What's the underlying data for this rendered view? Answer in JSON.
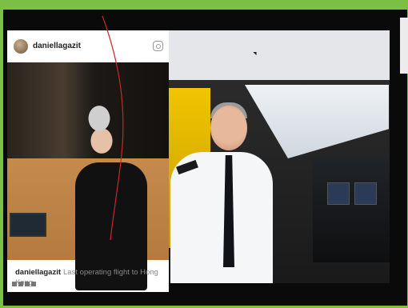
{
  "post": {
    "username": "daniellagazit",
    "caption_user": "daniellagazit",
    "caption_text": "Last operating flight to Hong Kong",
    "icons": [
      "instagram-icon",
      "share-icon",
      "edit-icon",
      "grid-icon",
      "arrow-icon"
    ]
  },
  "colors": {
    "border_green": "#7bc043",
    "frame_black": "#0a0a0a",
    "card_white": "#ffffff",
    "annotation_red": "#c62828"
  }
}
